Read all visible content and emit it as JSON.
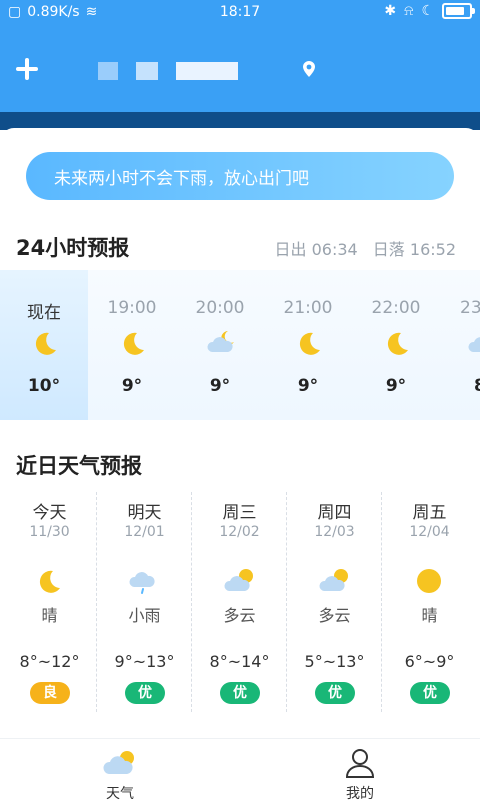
{
  "status_bar": {
    "network_speed": "0.89K/s",
    "time": "18:17"
  },
  "header": {
    "add_icon": "plus-icon",
    "location_icon": "location-pin-icon"
  },
  "banner": {
    "text": "未来两小时不会下雨，放心出门吧"
  },
  "hourly_section": {
    "title": "24小时预报",
    "sunrise": "日出 06:34",
    "sunset": "日落 16:52",
    "items": [
      {
        "label": "现在",
        "icon": "moon-icon",
        "temp": "10°"
      },
      {
        "label": "19:00",
        "icon": "moon-icon",
        "temp": "9°"
      },
      {
        "label": "20:00",
        "icon": "cloudy-night-icon",
        "temp": "9°"
      },
      {
        "label": "21:00",
        "icon": "moon-icon",
        "temp": "9°"
      },
      {
        "label": "22:00",
        "icon": "moon-icon",
        "temp": "9°"
      },
      {
        "label": "23",
        "icon": "cloud-icon",
        "temp": "8"
      }
    ]
  },
  "daily_section": {
    "title": "近日天气预报",
    "items": [
      {
        "day": "今天",
        "date": "11/30",
        "icon": "moon-icon",
        "weather": "晴",
        "range": "8°~12°",
        "aqi": "良",
        "aqi_color": "#f6b21a"
      },
      {
        "day": "明天",
        "date": "12/01",
        "icon": "light-rain-icon",
        "weather": "小雨",
        "range": "9°~13°",
        "aqi": "优",
        "aqi_color": "#19b777"
      },
      {
        "day": "周三",
        "date": "12/02",
        "icon": "partly-cloudy-icon",
        "weather": "多云",
        "range": "8°~14°",
        "aqi": "优",
        "aqi_color": "#19b777"
      },
      {
        "day": "周四",
        "date": "12/03",
        "icon": "partly-cloudy-icon",
        "weather": "多云",
        "range": "5°~13°",
        "aqi": "优",
        "aqi_color": "#19b777"
      },
      {
        "day": "周五",
        "date": "12/04",
        "icon": "sun-icon",
        "weather": "晴",
        "range": "6°~9°",
        "aqi": "优",
        "aqi_color": "#19b777"
      }
    ]
  },
  "bottom_nav": {
    "weather": "天气",
    "mine": "我的"
  },
  "colors": {
    "primary": "#3aa0f5",
    "accent": "#f6b21a",
    "good": "#19b777"
  }
}
